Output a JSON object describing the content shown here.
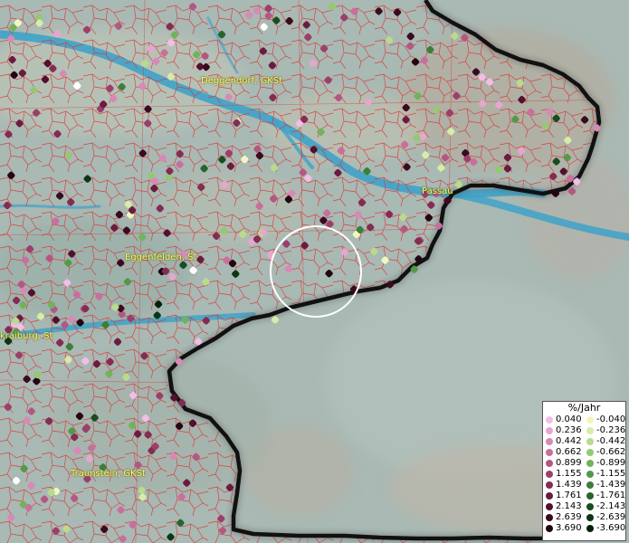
{
  "towns": [
    {
      "name": "Deggendorf, GKSt"
    },
    {
      "name": "Passau"
    },
    {
      "name": "Eggenfelden, St"
    },
    {
      "name": "kraiburg, St"
    },
    {
      "name": "Traunstein, GKSt"
    }
  ],
  "legend": {
    "title": "%/Jahr",
    "positive": [
      {
        "value": "0.040",
        "color": "#f2bde6"
      },
      {
        "value": "0.236",
        "color": "#e8a6cf"
      },
      {
        "value": "0.442",
        "color": "#d889b6"
      },
      {
        "value": "0.662",
        "color": "#c86f9d"
      },
      {
        "value": "0.899",
        "color": "#b35883"
      },
      {
        "value": "1.155",
        "color": "#9c3f6a"
      },
      {
        "value": "1.439",
        "color": "#842c53"
      },
      {
        "value": "1.761",
        "color": "#6b1c3e"
      },
      {
        "value": "2.143",
        "color": "#52102c"
      },
      {
        "value": "2.639",
        "color": "#3a0a1e"
      },
      {
        "value": "3.690",
        "color": "#240512"
      }
    ],
    "negative": [
      {
        "value": "-0.040",
        "color": "#f0f7c0"
      },
      {
        "value": "-0.236",
        "color": "#d7eca6"
      },
      {
        "value": "-0.442",
        "color": "#b8dc8c"
      },
      {
        "value": "-0.662",
        "color": "#95c873"
      },
      {
        "value": "-0.899",
        "color": "#73b25c"
      },
      {
        "value": "-1.155",
        "color": "#54994a"
      },
      {
        "value": "-1.439",
        "color": "#3b7f3a"
      },
      {
        "value": "-1.761",
        "color": "#28652c"
      },
      {
        "value": "-2.143",
        "color": "#194d20"
      },
      {
        "value": "-2.639",
        "color": "#0d3614"
      },
      {
        "value": "-3.690",
        "color": "#05200a"
      }
    ]
  },
  "colors": {
    "river": "#3fa2c8",
    "border": "#111111",
    "municipal_lines": "#dd3333",
    "town_label": "#ffff66",
    "terrain_de": "#9fb3ad",
    "terrain_at": "#a9b8b3"
  }
}
